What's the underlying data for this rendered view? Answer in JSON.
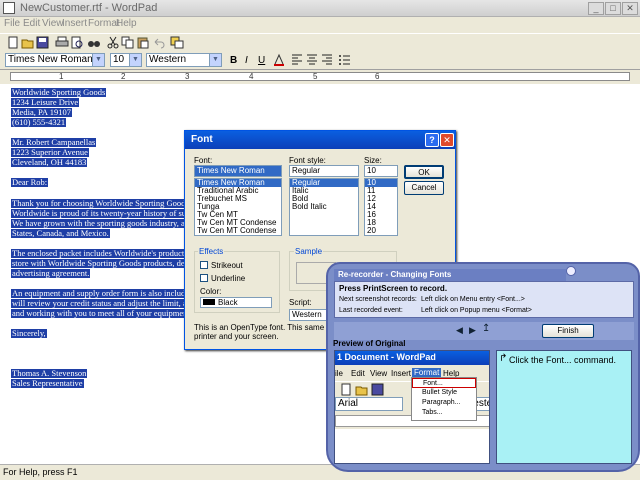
{
  "window": {
    "title": "NewCustomer.rtf - WordPad",
    "minimize": "_",
    "maximize": "□",
    "close": "✕"
  },
  "menu": [
    "File",
    "Edit",
    "View",
    "Insert",
    "Format",
    "Help"
  ],
  "format_bar": {
    "font": "Times New Roman",
    "size": "10",
    "script": "Western",
    "bold": "B",
    "italic": "I",
    "underline": "U"
  },
  "ruler": {
    "marks": [
      "1",
      "2",
      "3",
      "4",
      "5",
      "6"
    ]
  },
  "document": {
    "lines": [
      "Worldwide Sporting Goods",
      "1234 Leisure Drive",
      "Media, PA 19107",
      "(610) 555-4321",
      "",
      "Mr. Robert Campanellas",
      "1223 Superior Avenue",
      "Cleveland, OH  44183",
      "",
      "Dear Rob:",
      "",
      "Thank you for choosing Worldwide Sporting Goods",
      "Worldwide is proud of its twenty-year history of su",
      "We have grown with the sporting goods industry, a",
      "States, Canada, and Mexico.",
      "",
      "The enclosed packet includes Worldwide's product",
      "store with Worldwide Sporting Goods products, det",
      "advertising agreement.",
      "",
      "An equipment and supply order form is also include",
      "will review your credit status and adjust the limit, as",
      "and working with you to meet all of your equipment",
      "",
      "Sincerely,",
      "",
      "",
      "",
      "Thomas A. Stevenson",
      "Sales Representative"
    ]
  },
  "status": {
    "text": "For Help, press F1"
  },
  "font_dialog": {
    "title": "Font",
    "help": "?",
    "close": "✕",
    "font_label": "Font:",
    "font_value": "Times New Roman",
    "fonts": [
      "Times New Roman",
      "Traditional Arabic",
      "Trebuchet MS",
      "Tunga",
      "Tw Cen MT",
      "Tw Cen MT Condense",
      "Tw Cen MT Condense"
    ],
    "style_label": "Font style:",
    "style_value": "Regular",
    "styles": [
      "Regular",
      "Italic",
      "Bold",
      "Bold Italic"
    ],
    "size_label": "Size:",
    "size_value": "10",
    "sizes": [
      "10",
      "11",
      "12",
      "14",
      "16",
      "18",
      "20"
    ],
    "ok": "OK",
    "cancel": "Cancel",
    "effects_label": "Effects",
    "strikeout": "Strikeout",
    "underline": "Underline",
    "color_label": "Color:",
    "color_value": "Black",
    "sample_label": "Sample",
    "script_label": "Script:",
    "script_value": "Western",
    "note": "This is an OpenType font. This same font will",
    "note2": "printer and your screen."
  },
  "recorder": {
    "title": "Re-recorder - Changing Fonts",
    "instruction": "Press PrintScreen to record.",
    "next_label": "Next screenshot records:",
    "next_value": "Left click on Menu entry <Font...>",
    "last_label": "Last recorded event:",
    "last_value": "Left click on Popup menu <Format>",
    "finish": "Finish",
    "preview_label": "Preview of Original",
    "hint": "Click the Font... command.",
    "preview": {
      "title": "1 Document - WordPad",
      "menu": [
        "ile",
        "Edit",
        "View",
        "Insert",
        "Format",
        "Help"
      ],
      "popup": [
        "Font...",
        "Bullet Style",
        "Paragraph...",
        "Tabs..."
      ],
      "font": "Arial",
      "script": "Weste"
    }
  }
}
